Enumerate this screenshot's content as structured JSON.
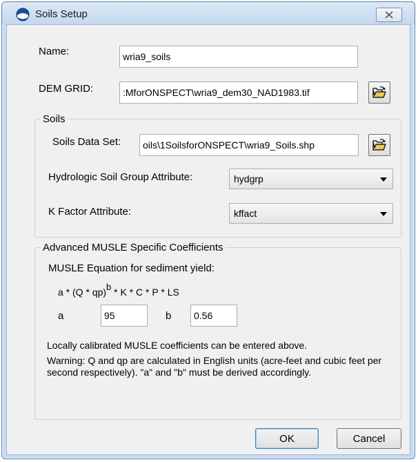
{
  "window": {
    "title": "Soils Setup",
    "icon": "noaa-logo-icon",
    "close_icon": "close-icon"
  },
  "form": {
    "name_label": "Name:",
    "name_value": "wria9_soils",
    "dem_label": "DEM GRID:",
    "dem_value": ":MforONSPECT\\wria9_dem30_NAD1983.tif",
    "browse_icon": "open-folder-icon"
  },
  "soils": {
    "legend": "Soils",
    "dataset_label": "Soils Data Set:",
    "dataset_value": "oils\\1SoilsforONSPECT\\wria9_Soils.shp",
    "hsg_label": "Hydrologic Soil Group Attribute:",
    "hsg_value": "hydgrp",
    "kfactor_label": "K Factor Attribute:",
    "kfactor_value": "kffact"
  },
  "musle": {
    "legend": "Advanced MUSLE Specific Coefficients",
    "equation_title": "MUSLE Equation for sediment yield:",
    "eq_prefix": "a * (Q * qp)",
    "eq_exp": "b",
    "eq_suffix": " * K * C * P * LS",
    "a_label": "a",
    "a_value": "95",
    "b_label": "b",
    "b_value": "0.56",
    "note1": "Locally calibrated MUSLE coefficients can be entered above.",
    "note2": "Warning: Q and qp are calculated in English units (acre-feet and cubic feet per second respectively). \"a\" and \"b\" must be derived accordingly."
  },
  "buttons": {
    "ok": "OK",
    "cancel": "Cancel"
  },
  "colors": {
    "frame": "#c7dcf2",
    "client": "#f0f0f0",
    "default_button_border": "#3c7fb1"
  }
}
